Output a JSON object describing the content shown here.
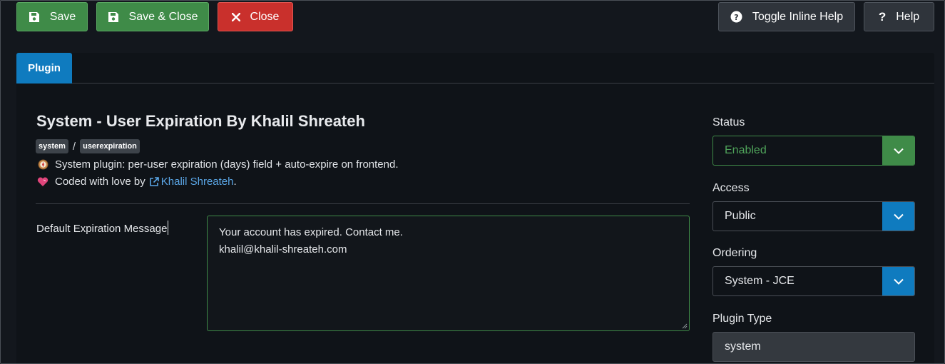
{
  "toolbar": {
    "save_label": "Save",
    "save_close_label": "Save & Close",
    "close_label": "Close",
    "toggle_help_label": "Toggle Inline Help",
    "help_label": "Help"
  },
  "tabs": [
    {
      "label": "Plugin",
      "active": true
    }
  ],
  "plugin": {
    "title": "System - User Expiration By Khalil Shreateh",
    "badges": [
      "system",
      "userexpiration"
    ],
    "badge_separator": "/",
    "description": "System plugin: per-user expiration (days) field + auto-expire on frontend.",
    "credit_prefix": "Coded with love by",
    "credit_link": "Khalil Shreateh",
    "credit_suffix": ".",
    "icons": {
      "description": "compass-icon",
      "credit": "heart-icon",
      "link": "external-link-icon"
    }
  },
  "form": {
    "message_label": "Default Expiration Message",
    "message_value": "Your account has expired. Contact me.\nkhalil@khalil-shreateh.com"
  },
  "side": {
    "status_label": "Status",
    "status_value": "Enabled",
    "access_label": "Access",
    "access_value": "Public",
    "ordering_label": "Ordering",
    "ordering_value": "System - JCE",
    "type_label": "Plugin Type",
    "type_value": "system"
  },
  "colors": {
    "success": "#3f8b48",
    "danger": "#c9302c",
    "primary": "#0f7bbf",
    "link": "#5aa6e6"
  }
}
